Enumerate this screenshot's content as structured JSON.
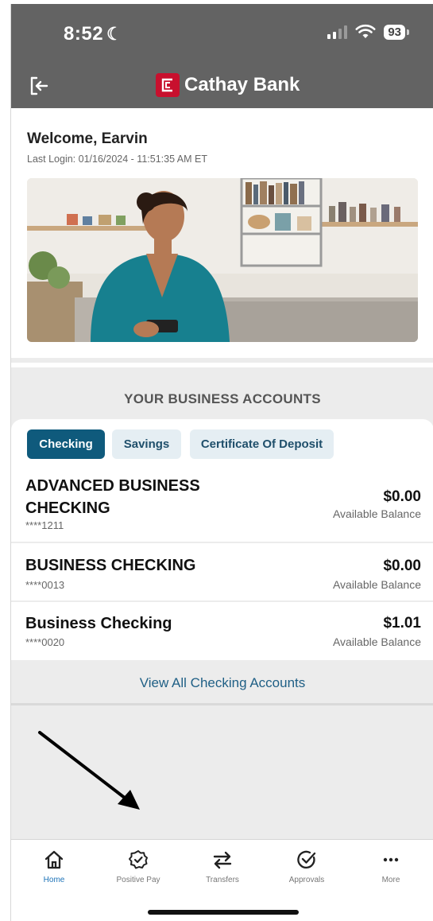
{
  "status_bar": {
    "time": "8:52",
    "battery": "93"
  },
  "header": {
    "brand": "Cathay Bank"
  },
  "welcome": {
    "greeting": "Welcome, Earvin",
    "last_login": "Last Login: 01/16/2024 - 11:51:35 AM ET"
  },
  "accounts": {
    "section_title": "YOUR BUSINESS ACCOUNTS",
    "tabs": [
      {
        "label": "Checking",
        "active": true
      },
      {
        "label": "Savings",
        "active": false
      },
      {
        "label": "Certificate Of Deposit",
        "active": false
      }
    ],
    "items": [
      {
        "name": "ADVANCED BUSINESS CHECKING",
        "number": "****1211",
        "balance": "$0.00",
        "balance_label": "Available Balance"
      },
      {
        "name": "BUSINESS CHECKING",
        "number": "****0013",
        "balance": "$0.00",
        "balance_label": "Available Balance"
      },
      {
        "name": "Business Checking",
        "number": "****0020",
        "balance": "$1.01",
        "balance_label": "Available Balance"
      }
    ],
    "view_all": "View All Checking Accounts"
  },
  "bottom_nav": [
    {
      "label": "Home",
      "icon": "home-icon",
      "active": true
    },
    {
      "label": "Positive Pay",
      "icon": "badge-check-icon",
      "active": false
    },
    {
      "label": "Transfers",
      "icon": "transfer-arrows-icon",
      "active": false
    },
    {
      "label": "Approvals",
      "icon": "check-circle-icon",
      "active": false
    },
    {
      "label": "More",
      "icon": "more-dots-icon",
      "active": false
    }
  ],
  "colors": {
    "header_bg": "#636363",
    "brand_red": "#c8102e",
    "tab_active": "#0f5a7c",
    "tab_inactive": "#e5eef3",
    "link": "#1f5f85",
    "nav_active": "#1d73b8"
  }
}
